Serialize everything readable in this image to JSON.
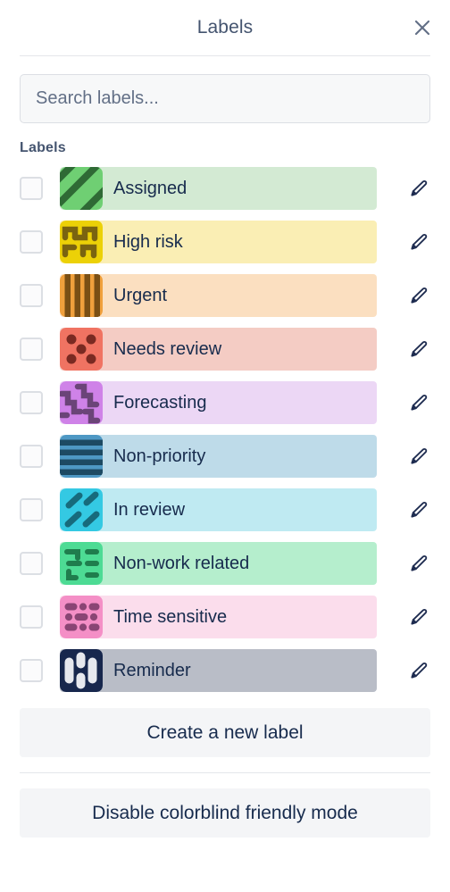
{
  "header": {
    "title": "Labels",
    "close_icon": "close-icon"
  },
  "search": {
    "placeholder": "Search labels...",
    "value": "",
    "icon": "search-input"
  },
  "section": {
    "title": "Labels"
  },
  "colors": {
    "text": "#172b4d",
    "muted_text": "#44546f",
    "divider": "#e4e6ea",
    "checkbox_border": "#dcdfe4",
    "button_bg": "#f4f5f7",
    "search_bg": "#f7f8f9"
  },
  "labels": [
    {
      "name": "Assigned",
      "checked": false,
      "pattern": "diagonal-stripes",
      "chip_bg": "#d3ead3",
      "swatch_bg": "#6fcf73",
      "pattern_color": "#2f6a35",
      "edit_icon": "pencil-icon"
    },
    {
      "name": "High risk",
      "checked": false,
      "pattern": "zigzag-maze",
      "chip_bg": "#faeeb4",
      "swatch_bg": "#ecd107",
      "pattern_color": "#7a6410",
      "edit_icon": "pencil-icon"
    },
    {
      "name": "Urgent",
      "checked": false,
      "pattern": "vertical-stripes",
      "chip_bg": "#fbdfc0",
      "swatch_bg": "#f0a03c",
      "pattern_color": "#7a4f14",
      "edit_icon": "pencil-icon"
    },
    {
      "name": "Needs review",
      "checked": false,
      "pattern": "dots",
      "chip_bg": "#f4ccc4",
      "swatch_bg": "#f07362",
      "pattern_color": "#7a2a22",
      "edit_icon": "pencil-icon"
    },
    {
      "name": "Forecasting",
      "checked": false,
      "pattern": "wavy-lines",
      "chip_bg": "#ecd7f5",
      "swatch_bg": "#cf82e8",
      "pattern_color": "#6b4478",
      "edit_icon": "pencil-icon"
    },
    {
      "name": "Non-priority",
      "checked": false,
      "pattern": "horizontal-stripes",
      "chip_bg": "#bedbe9",
      "swatch_bg": "#4e98c4",
      "pattern_color": "#1d4a63",
      "edit_icon": "pencil-icon"
    },
    {
      "name": "In review",
      "checked": false,
      "pattern": "diagonal-dashes",
      "chip_bg": "#bfeaf2",
      "swatch_bg": "#34c9e3",
      "pattern_color": "#176b7c",
      "edit_icon": "pencil-icon"
    },
    {
      "name": "Non-work related",
      "checked": false,
      "pattern": "broken-lines",
      "chip_bg": "#b5eecd",
      "swatch_bg": "#4ddb94",
      "pattern_color": "#1f7d4d",
      "edit_icon": "pencil-icon"
    },
    {
      "name": "Time sensitive",
      "checked": false,
      "pattern": "dash-dot-grid",
      "chip_bg": "#fbddec",
      "swatch_bg": "#f48fc6",
      "pattern_color": "#8a4574",
      "edit_icon": "pencil-icon"
    },
    {
      "name": "Reminder",
      "checked": false,
      "pattern": "capsule-bars",
      "chip_bg": "#b9bdc7",
      "swatch_bg": "#17274d",
      "pattern_color": "#e6e8ee",
      "edit_icon": "pencil-icon"
    }
  ],
  "footer": {
    "create_label": "Create a new label",
    "colorblind_toggle": "Disable colorblind friendly mode"
  }
}
